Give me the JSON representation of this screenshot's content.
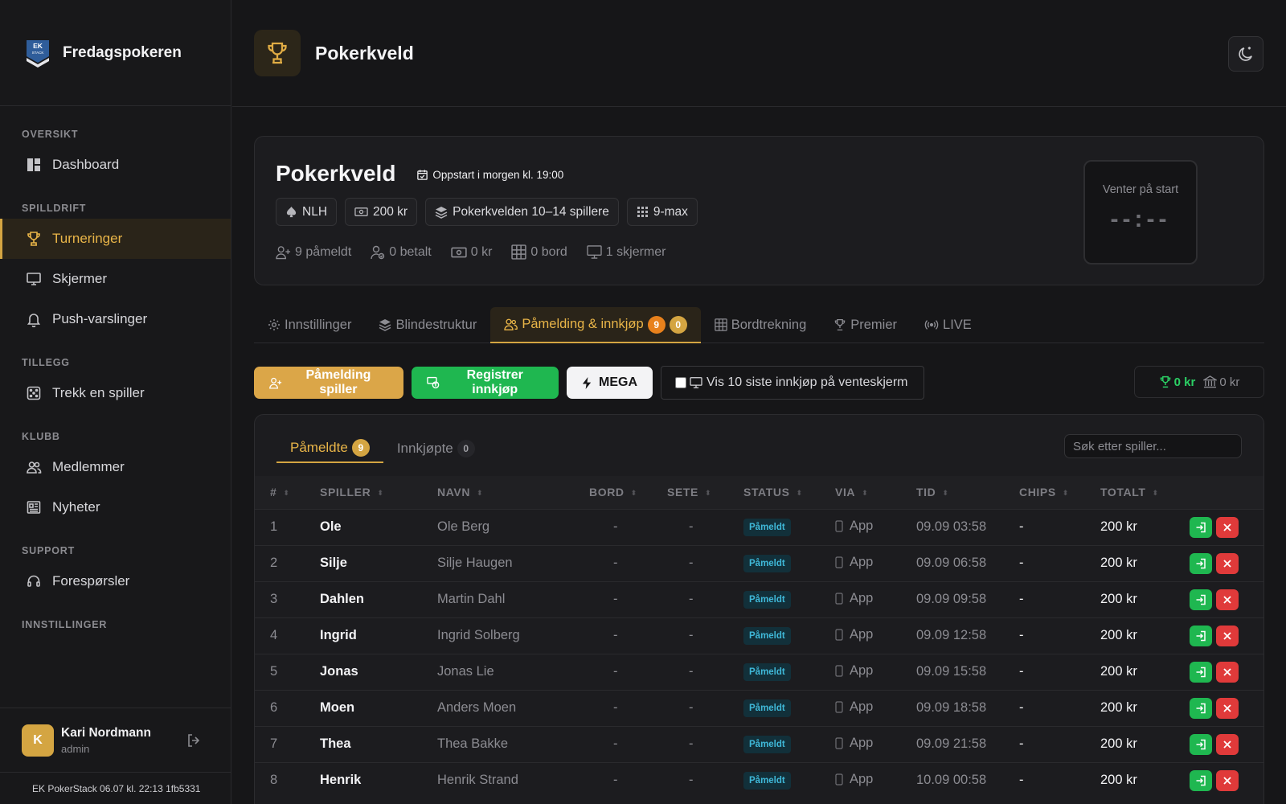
{
  "brand": {
    "name": "Fredagspokeren",
    "logo_text_top": "EK",
    "logo_text_bottom": "STACK"
  },
  "sidebar": {
    "sections": {
      "oversikt": "OVERSIKT",
      "spilldrift": "SPILLDRIFT",
      "tillegg": "TILLEGG",
      "klubb": "KLUBB",
      "support": "SUPPORT",
      "innstillinger": "INNSTILLINGER"
    },
    "items": {
      "dashboard": "Dashboard",
      "turneringer": "Turneringer",
      "skjermer": "Skjermer",
      "push": "Push-varslinger",
      "trekk": "Trekk en spiller",
      "medlemmer": "Medlemmer",
      "nyheter": "Nyheter",
      "foresporsler": "Forespørsler"
    },
    "user": {
      "initial": "K",
      "name": "Kari Nordmann",
      "role": "admin"
    },
    "version": "EK PokerStack 06.07 kl. 22:13 1fb5331"
  },
  "header": {
    "title": "Pokerkveld"
  },
  "tournament": {
    "title": "Pokerkveld",
    "start": "Oppstart i morgen kl. 19:00",
    "chips": {
      "game": "NLH",
      "buyin": "200 kr",
      "structure": "Pokerkvelden 10–14 spillere",
      "max": "9-max"
    },
    "stats": {
      "registered": "9 påmeldt",
      "paid": "0 betalt",
      "amount": "0 kr",
      "tables": "0 bord",
      "screens": "1 skjermer"
    },
    "timer": {
      "label": "Venter på start",
      "value": "--:--"
    }
  },
  "tabs": {
    "settings": "Innstillinger",
    "blinds": "Blindestruktur",
    "registration": "Påmelding & innkjøp",
    "registration_badge_a": "9",
    "registration_badge_b": "0",
    "seating": "Bordtrekning",
    "prizes": "Premier",
    "live": "LIVE"
  },
  "actions": {
    "register_player": "Påmelding spiller",
    "register_buyin": "Registrer innkjøp",
    "mega": "MEGA",
    "show_last": "Vis 10 siste innkjøp på venteskjerm",
    "prize_total": "0 kr",
    "bank_total": "0 kr"
  },
  "list": {
    "tab_registered": "Påmeldte",
    "tab_registered_count": "9",
    "tab_bought": "Innkjøpte",
    "tab_bought_count": "0",
    "search_placeholder": "Søk etter spiller...",
    "columns": {
      "num": "#",
      "player": "SPILLER",
      "name": "NAVN",
      "table": "BORD",
      "seat": "SETE",
      "status": "STATUS",
      "via": "VIA",
      "time": "TID",
      "chips": "CHIPS",
      "total": "TOTALT"
    },
    "rows": [
      {
        "num": "1",
        "player": "Ole",
        "name": "Ole Berg",
        "table": "-",
        "seat": "-",
        "status": "Påmeldt",
        "via": "App",
        "time": "09.09 03:58",
        "chips": "-",
        "total": "200 kr"
      },
      {
        "num": "2",
        "player": "Silje",
        "name": "Silje Haugen",
        "table": "-",
        "seat": "-",
        "status": "Påmeldt",
        "via": "App",
        "time": "09.09 06:58",
        "chips": "-",
        "total": "200 kr"
      },
      {
        "num": "3",
        "player": "Dahlen",
        "name": "Martin Dahl",
        "table": "-",
        "seat": "-",
        "status": "Påmeldt",
        "via": "App",
        "time": "09.09 09:58",
        "chips": "-",
        "total": "200 kr"
      },
      {
        "num": "4",
        "player": "Ingrid",
        "name": "Ingrid Solberg",
        "table": "-",
        "seat": "-",
        "status": "Påmeldt",
        "via": "App",
        "time": "09.09 12:58",
        "chips": "-",
        "total": "200 kr"
      },
      {
        "num": "5",
        "player": "Jonas",
        "name": "Jonas Lie",
        "table": "-",
        "seat": "-",
        "status": "Påmeldt",
        "via": "App",
        "time": "09.09 15:58",
        "chips": "-",
        "total": "200 kr"
      },
      {
        "num": "6",
        "player": "Moen",
        "name": "Anders Moen",
        "table": "-",
        "seat": "-",
        "status": "Påmeldt",
        "via": "App",
        "time": "09.09 18:58",
        "chips": "-",
        "total": "200 kr"
      },
      {
        "num": "7",
        "player": "Thea",
        "name": "Thea Bakke",
        "table": "-",
        "seat": "-",
        "status": "Påmeldt",
        "via": "App",
        "time": "09.09 21:58",
        "chips": "-",
        "total": "200 kr"
      },
      {
        "num": "8",
        "player": "Henrik",
        "name": "Henrik Strand",
        "table": "-",
        "seat": "-",
        "status": "Påmeldt",
        "via": "App",
        "time": "10.09 00:58",
        "chips": "-",
        "total": "200 kr"
      }
    ]
  }
}
